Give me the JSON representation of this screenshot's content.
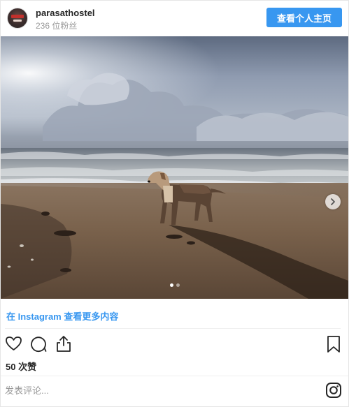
{
  "header": {
    "username": "parasathostel",
    "followers": "236 位粉丝",
    "view_profile_label": "查看个人主页"
  },
  "post": {
    "icons": {
      "next": "chevron-right-icon",
      "like": "heart-icon",
      "comment": "comment-icon",
      "share": "share-icon",
      "save": "bookmark-icon",
      "instagram": "instagram-logo-icon"
    },
    "carousel": {
      "total": 2,
      "current": 1
    },
    "ig_link_label": "在 Instagram 查看更多内容",
    "likes": "50 次赞",
    "comment_placeholder": "发表评论..."
  },
  "colors": {
    "accent": "#3897f0",
    "text": "#262626",
    "muted": "#999999"
  }
}
